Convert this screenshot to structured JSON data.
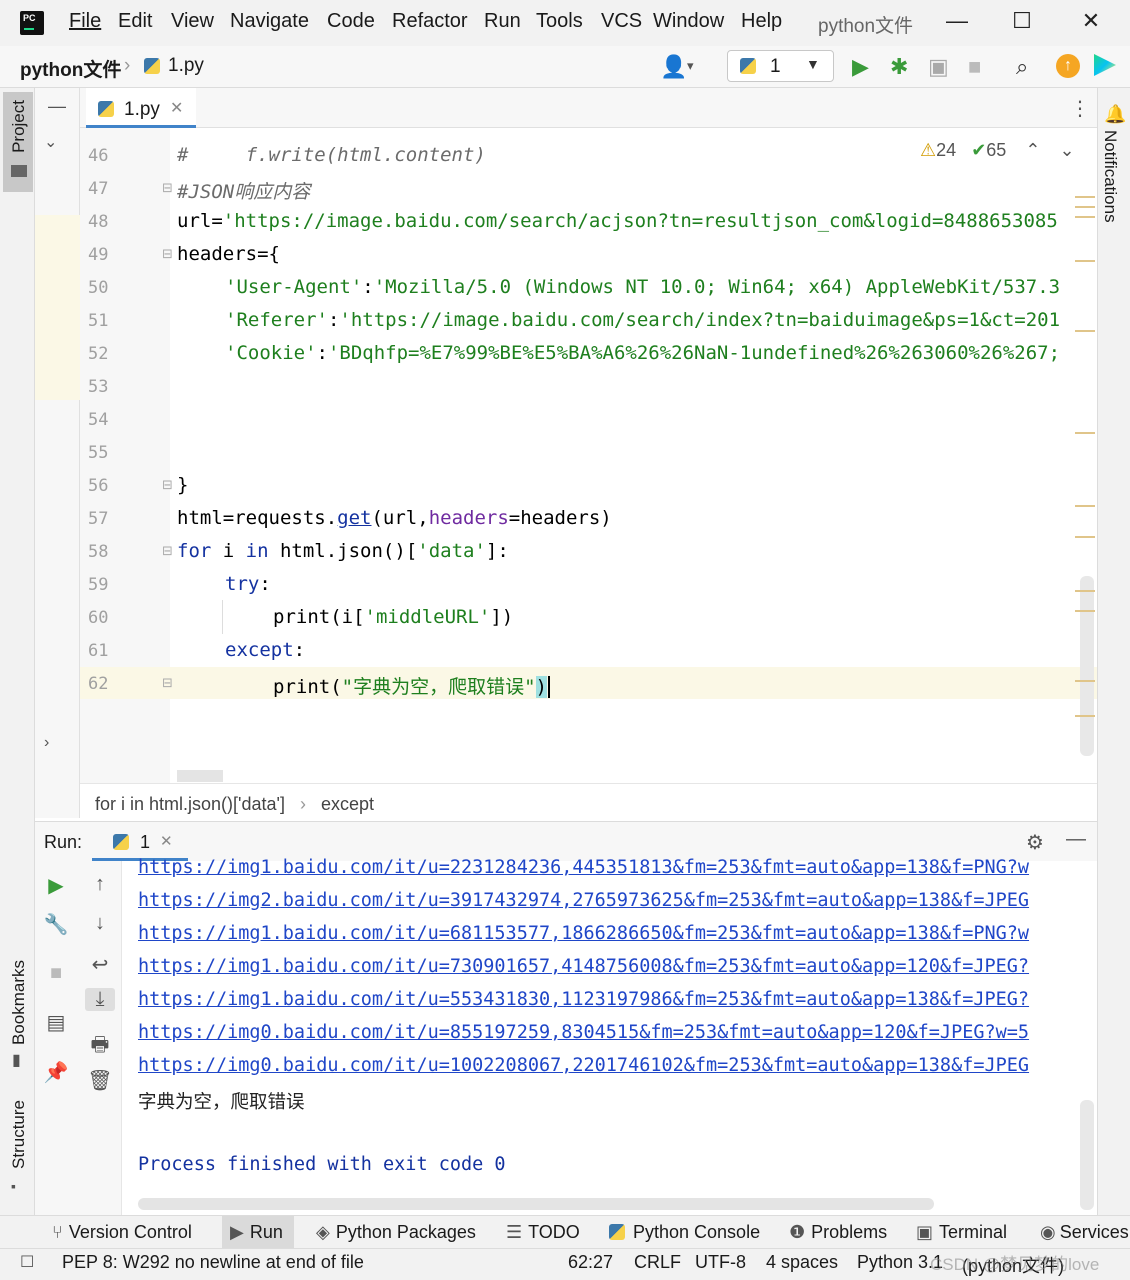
{
  "menu": {
    "items": [
      "File",
      "Edit",
      "View",
      "Navigate",
      "Code",
      "Refactor",
      "Run",
      "Tools",
      "VCS",
      "Window",
      "Help"
    ],
    "project_title": "python文件"
  },
  "window": {
    "minimize": "—",
    "maximize": "☐",
    "close": "✕"
  },
  "navbar": {
    "project": "python文件",
    "file": "1.py",
    "run_config": "1"
  },
  "editor": {
    "tab": "1.py",
    "inspections": {
      "warnings": "24",
      "weak_warnings": "65"
    },
    "lines": [
      {
        "n": "46",
        "text": "#     f.write(html.content)"
      },
      {
        "n": "47",
        "text": "#JSON响应内容"
      },
      {
        "n": "48",
        "a": "url=",
        "b": "'https://image.baidu.com/search/acjson?tn=resultjson_com&logid=8488653085"
      },
      {
        "n": "49",
        "text": "headers={"
      },
      {
        "n": "50",
        "a": "'User-Agent'",
        "b": ":",
        "c": "'Mozilla/5.0 (Windows NT 10.0; Win64; x64) AppleWebKit/537.3"
      },
      {
        "n": "51",
        "a": "'Referer'",
        "b": ":",
        "c": "'https://image.baidu.com/search/index?tn=baiduimage&ps=1&ct=201"
      },
      {
        "n": "52",
        "a": "'Cookie'",
        "b": ":",
        "c": "'BDqhfp=%E7%99%BE%E5%BA%A6%26%26NaN-1undefined%26%263060%26%267;"
      },
      {
        "n": "53"
      },
      {
        "n": "54"
      },
      {
        "n": "55"
      },
      {
        "n": "56",
        "text": "}"
      },
      {
        "n": "57",
        "a": "html=requests.",
        "b": "get",
        "c": "(url,",
        "d": "headers",
        "e": "=headers)"
      },
      {
        "n": "58",
        "a": "for",
        "b": " i ",
        "c": "in",
        "d": " html.json()[",
        "e": "'data'",
        "f": "]:"
      },
      {
        "n": "59",
        "a": "try",
        "b": ":"
      },
      {
        "n": "60",
        "a": "print(i[",
        "b": "'middleURL'",
        "c": "])"
      },
      {
        "n": "61",
        "a": "except",
        "b": ":"
      },
      {
        "n": "62",
        "a": "print(",
        "b": "\"字典为空，爬取错误\"",
        "c": ")"
      }
    ],
    "breadcrumbs": [
      "for i in html.json()['data']",
      "except"
    ]
  },
  "run": {
    "label": "Run:",
    "tab": "1",
    "output": [
      "https://img1.baidu.com/it/u=2231284236,445351813&fm=253&fmt=auto&app=138&f=PNG?w",
      "https://img2.baidu.com/it/u=3917432974,2765973625&fm=253&fmt=auto&app=138&f=JPEG",
      "https://img1.baidu.com/it/u=681153577,1866286650&fm=253&fmt=auto&app=138&f=PNG?w",
      "https://img1.baidu.com/it/u=730901657,4148756008&fm=253&fmt=auto&app=120&f=JPEG?",
      "https://img1.baidu.com/it/u=553431830,1123197986&fm=253&fmt=auto&app=138&f=JPEG?",
      "https://img0.baidu.com/it/u=855197259,8304515&fm=253&fmt=auto&app=120&f=JPEG?w=5",
      "https://img0.baidu.com/it/u=1002208067,2201746102&fm=253&fmt=auto&app=138&f=JPEG"
    ],
    "error_msg": "字典为空，爬取错误",
    "finish_msg": "Process finished with exit code 0"
  },
  "side": {
    "project": "Project",
    "bookmarks": "Bookmarks",
    "structure": "Structure",
    "notifications": "Notifications"
  },
  "toolwindows": [
    "Version Control",
    "Run",
    "Python Packages",
    "TODO",
    "Python Console",
    "Problems",
    "Terminal",
    "Services"
  ],
  "status": {
    "message": "PEP 8: W292 no newline at end of file",
    "position": "62:27",
    "line_sep": "CRLF",
    "encoding": "UTF-8",
    "indent": "4 spaces",
    "interpreter": "Python 3.1",
    "project": "(python文件)",
    "watermark": "CSDN @梦见梦的love"
  }
}
